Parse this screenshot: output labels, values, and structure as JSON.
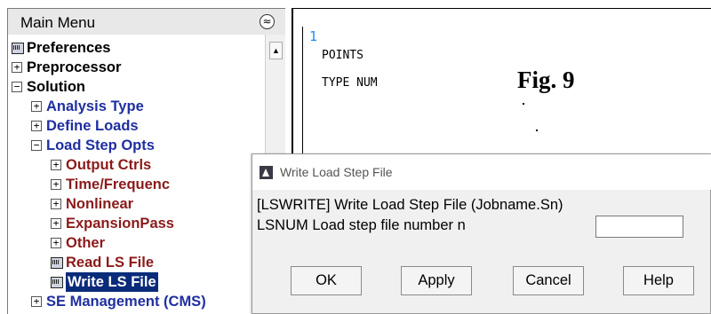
{
  "main_menu": {
    "title": "Main Menu",
    "collapse_glyph": "≈",
    "scroll_up_glyph": "▲",
    "items": [
      {
        "icon": "doc",
        "label": "Preferences",
        "color": "#000000"
      },
      {
        "icon": "+",
        "label": "Preprocessor",
        "color": "#000000"
      },
      {
        "icon": "−",
        "label": "Solution",
        "color": "#000000"
      },
      {
        "icon": "+",
        "label": "Analysis Type",
        "color": "#1f2fa0"
      },
      {
        "icon": "+",
        "label": "Define Loads",
        "color": "#1f2fa0"
      },
      {
        "icon": "−",
        "label": "Load Step Opts",
        "color": "#1f2fa0"
      },
      {
        "icon": "+",
        "label": "Output Ctrls",
        "color": "#8b1a1a"
      },
      {
        "icon": "+",
        "label": "Time/Frequenc",
        "color": "#8b1a1a"
      },
      {
        "icon": "+",
        "label": "Nonlinear",
        "color": "#8b1a1a"
      },
      {
        "icon": "+",
        "label": "ExpansionPass",
        "color": "#8b1a1a"
      },
      {
        "icon": "+",
        "label": "Other",
        "color": "#8b1a1a"
      },
      {
        "icon": "doc",
        "label": "Read LS File",
        "color": "#8b1a1a"
      },
      {
        "icon": "doc",
        "label": "Write LS File",
        "color": "#ffffff",
        "selected": true
      },
      {
        "icon": "+",
        "label": "SE Management (CMS)",
        "color": "#1f2fa0"
      }
    ]
  },
  "graphics": {
    "window_number": "1",
    "line1": "POINTS",
    "line2": "TYPE NUM",
    "figure_label": "Fig. 9"
  },
  "dialog": {
    "title": "Write Load Step File",
    "command_line": "[LSWRITE]  Write Load Step File (Jobname.Sn)",
    "field_label": "LSNUM  Load step file number n",
    "field_value": "",
    "buttons": {
      "ok": "OK",
      "apply": "Apply",
      "cancel": "Cancel",
      "help": "Help"
    }
  },
  "colors": {
    "selection_bg": "#0a2b7a",
    "menu_blue": "#1f2fa0",
    "menu_red": "#8b1a1a",
    "window_number": "#1a8cff"
  }
}
